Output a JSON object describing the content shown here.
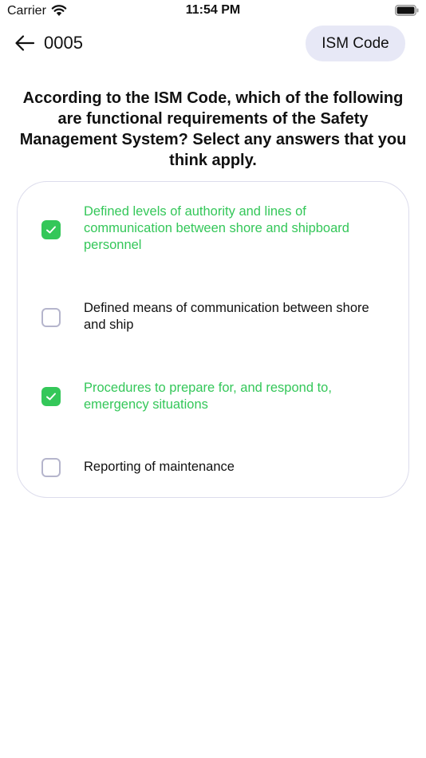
{
  "status_bar": {
    "carrier": "Carrier",
    "time": "11:54 PM",
    "icons": [
      "wifi-icon",
      "battery-icon"
    ]
  },
  "header": {
    "back_icon": "arrow-left-icon",
    "question_id": "0005",
    "topic": "ISM Code"
  },
  "question": {
    "text": "According to the ISM Code, which of the following are functional requirements of the Safety Management System? Select any answers that you think apply."
  },
  "options": [
    {
      "label": "Defined levels of authority and lines of communication between shore and shipboard personnel",
      "selected": true
    },
    {
      "label": "Defined means of communication between shore and ship",
      "selected": false
    },
    {
      "label": "Procedures to prepare for, and respond to, emergency situations",
      "selected": true
    },
    {
      "label": "Reporting of maintenance",
      "selected": false
    }
  ],
  "colors": {
    "accent_green": "#34c759",
    "pill_background": "#e7e8f6",
    "checkbox_border": "#b5b5cc",
    "card_border": "#dcdcec"
  }
}
